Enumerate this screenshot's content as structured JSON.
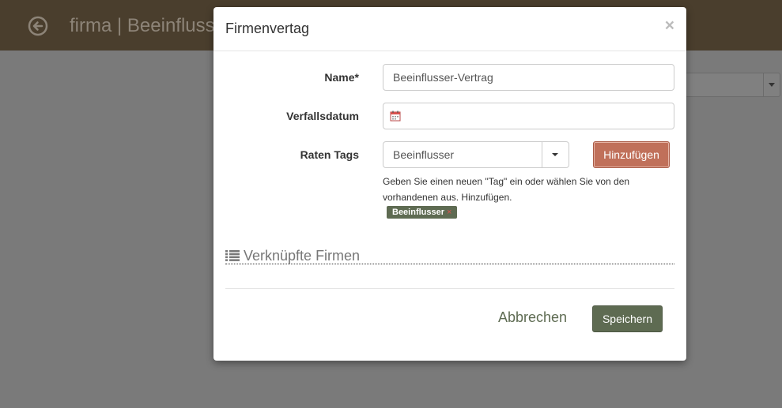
{
  "background": {
    "title": "firma | Beeinflusser",
    "header_color": "#4a3e2d"
  },
  "modal": {
    "title": "Firmenvertag",
    "close_label": "×",
    "fields": {
      "name_label": "Name*",
      "name_value": "Beeinflusser-Vertrag",
      "expiry_label": "Verfallsdatum",
      "expiry_value": "",
      "tags_label": "Raten Tags",
      "tags_value": "Beeinflusser",
      "add_button": "Hinzufügen",
      "help_text": "Geben Sie einen neuen \"Tag\" ein oder wählen Sie von den vorhandenen aus. Hinzufügen."
    },
    "tags": [
      {
        "label": "Beeinflusser",
        "remove": "×"
      }
    ],
    "section_title": "Verknüpfte Firmen",
    "footer": {
      "cancel_label": "Abbrechen",
      "save_label": "Speichern"
    }
  },
  "colors": {
    "accent": "#5e6b52",
    "danger_button": "#c0705a",
    "overlay": "#7a7a7a"
  }
}
